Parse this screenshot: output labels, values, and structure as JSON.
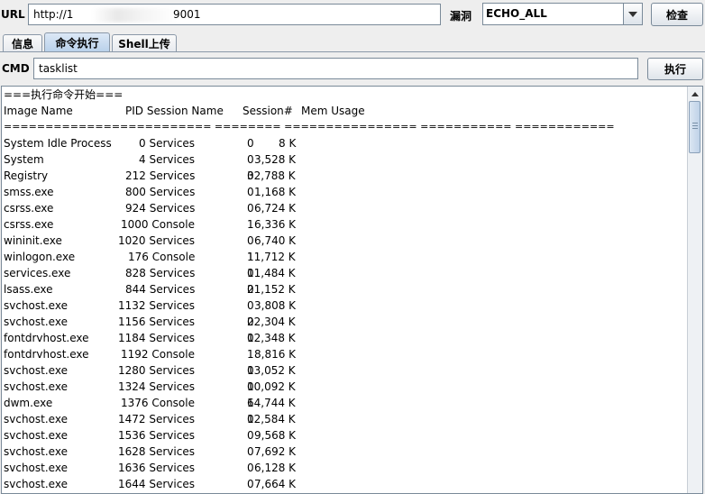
{
  "top": {
    "url_label": "URL",
    "url_left": "http://1",
    "url_right": "9001",
    "vuln_label": "漏洞",
    "vuln_selected": "ECHO_ALL",
    "check_button": "检查"
  },
  "tabs": [
    {
      "label": "信息"
    },
    {
      "label": "命令执行"
    },
    {
      "label": "Shell上传"
    }
  ],
  "cmd": {
    "label": "CMD",
    "value": "tasklist",
    "exec_button": "执行"
  },
  "output": {
    "start_line": "===执行命令开始===",
    "header": [
      "Image Name",
      "PID Session Name",
      "Session#",
      "Mem Usage"
    ],
    "separator": "========================= ======== ================ =========== ============",
    "rows": [
      [
        "System Idle Process",
        "0 Services",
        "0",
        "8 K"
      ],
      [
        "System",
        "4 Services",
        "0",
        "3,528 K"
      ],
      [
        "Registry",
        "212 Services",
        "0",
        "32,788 K"
      ],
      [
        "smss.exe",
        "800 Services",
        "0",
        "1,168 K"
      ],
      [
        "csrss.exe",
        "924 Services",
        "0",
        "6,724 K"
      ],
      [
        "csrss.exe",
        "1000 Console",
        "1",
        "6,336 K"
      ],
      [
        "wininit.exe",
        "1020 Services",
        "0",
        "6,740 K"
      ],
      [
        "winlogon.exe",
        "176 Console",
        "1",
        "11,712 K"
      ],
      [
        "services.exe",
        "828 Services",
        "0",
        "11,484 K"
      ],
      [
        "lsass.exe",
        "844 Services",
        "0",
        "21,152 K"
      ],
      [
        "svchost.exe",
        "1132 Services",
        "0",
        "3,808 K"
      ],
      [
        "svchost.exe",
        "1156 Services",
        "0",
        "22,304 K"
      ],
      [
        "fontdrvhost.exe",
        "1184 Services",
        "0",
        "12,348 K"
      ],
      [
        "fontdrvhost.exe",
        "1192 Console",
        "1",
        "8,816 K"
      ],
      [
        "svchost.exe",
        "1280 Services",
        "0",
        "13,052 K"
      ],
      [
        "svchost.exe",
        "1324 Services",
        "0",
        "10,092 K"
      ],
      [
        "dwm.exe",
        "1376 Console",
        "1",
        "64,744 K"
      ],
      [
        "svchost.exe",
        "1472 Services",
        "0",
        "12,584 K"
      ],
      [
        "svchost.exe",
        "1536 Services",
        "0",
        "9,568 K"
      ],
      [
        "svchost.exe",
        "1628 Services",
        "0",
        "7,692 K"
      ],
      [
        "svchost.exe",
        "1636 Services",
        "0",
        "6,128 K"
      ],
      [
        "svchost.exe",
        "1644 Services",
        "0",
        "7,664 K"
      ]
    ]
  }
}
